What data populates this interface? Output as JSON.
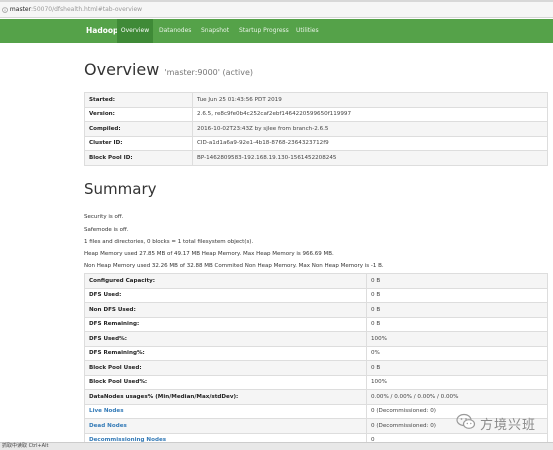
{
  "browser": {
    "url_host": "master",
    "url_path": ":50070/dfshealth.html#tab-overview"
  },
  "navbar": {
    "brand": "Hadoop",
    "items": [
      {
        "label": "Overview",
        "active": true
      },
      {
        "label": "Datanodes",
        "active": false
      },
      {
        "label": "Snapshot",
        "active": false
      },
      {
        "label": "Startup Progress",
        "active": false
      },
      {
        "label": "Utilities",
        "active": false
      }
    ]
  },
  "overview": {
    "title": "Overview",
    "subtitle": "'master:9000' (active)",
    "rows": [
      {
        "key": "Started:",
        "value": "Tue Jun 25 01:43:56 PDT 2019"
      },
      {
        "key": "Version:",
        "value": "2.6.5, re8c9fe0b4c252caf2ebf1464220599650f119997"
      },
      {
        "key": "Compiled:",
        "value": "2016-10-02T23:43Z by sjlee from branch-2.6.5"
      },
      {
        "key": "Cluster ID:",
        "value": "CID-a1d1a6a9-92e1-4b18-8768-2364323712f9"
      },
      {
        "key": "Block Pool ID:",
        "value": "BP-1462809583-192.168.19.130-1561452208245"
      }
    ]
  },
  "summary": {
    "title": "Summary",
    "lines": [
      "Security is off.",
      "Safemode is off.",
      "1 files and directories, 0 blocks = 1 total filesystem object(s).",
      "Heap Memory used 27.85 MB of 49.17 MB Heap Memory. Max Heap Memory is 966.69 MB.",
      "Non Heap Memory used 32.26 MB of 32.88 MB Commited Non Heap Memory. Max Non Heap Memory is -1 B."
    ],
    "rows": [
      {
        "key": "Configured Capacity:",
        "value": "0 B"
      },
      {
        "key": "DFS Used:",
        "value": "0 B"
      },
      {
        "key": "Non DFS Used:",
        "value": "0 B"
      },
      {
        "key": "DFS Remaining:",
        "value": "0 B"
      },
      {
        "key": "DFS Used%:",
        "value": "100%"
      },
      {
        "key": "DFS Remaining%:",
        "value": "0%"
      },
      {
        "key": "Block Pool Used:",
        "value": "0 B"
      },
      {
        "key": "Block Pool Used%:",
        "value": "100%"
      },
      {
        "key": "DataNodes usages% (Min/Median/Max/stdDev):",
        "value": "0.00% / 0.00% / 0.00% / 0.00%"
      }
    ],
    "link_rows": [
      {
        "key": "Live Nodes",
        "value": "0 (Decommissioned: 0)"
      },
      {
        "key": "Dead Nodes",
        "value": "0 (Decommissioned: 0)"
      },
      {
        "key": "Decommissioning Nodes",
        "value": "0"
      }
    ]
  },
  "watermark": {
    "text": "方境兴班",
    "icon": "wechat-icon"
  },
  "statusbar": {
    "text": "抓取中读取 Ctrl+Alt"
  },
  "colors": {
    "navbar": "#55a249",
    "navbar_active": "#3f8a37",
    "link": "#337ab7"
  }
}
